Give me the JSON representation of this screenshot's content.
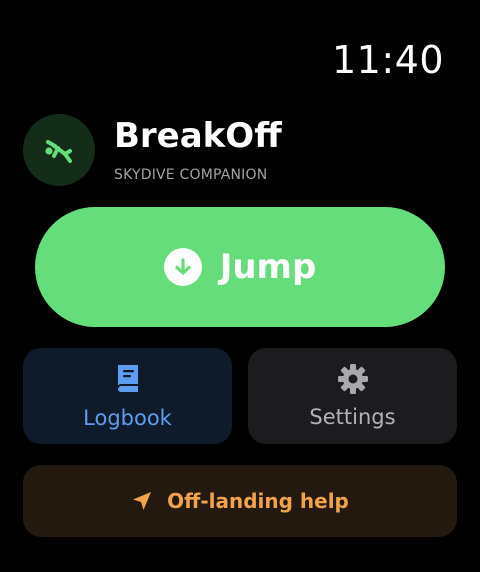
{
  "status_bar": {
    "time": "11:40"
  },
  "header": {
    "title": "BreakOff",
    "subtitle": "SKYDIVE COMPANION",
    "icon": "skydiver-icon"
  },
  "primary_action": {
    "label": "Jump",
    "icon": "arrow-down-circle-icon"
  },
  "tiles": [
    {
      "label": "Logbook",
      "icon": "book-icon"
    },
    {
      "label": "Settings",
      "icon": "gear-icon"
    }
  ],
  "help_action": {
    "label": "Off-landing help",
    "icon": "location-arrow-icon"
  },
  "colors": {
    "background": "#000000",
    "jump_green": "#64dd7a",
    "logbook_blue": "#5e9df0",
    "settings_gray": "#b3b3b3",
    "help_orange": "#f1a34a"
  }
}
